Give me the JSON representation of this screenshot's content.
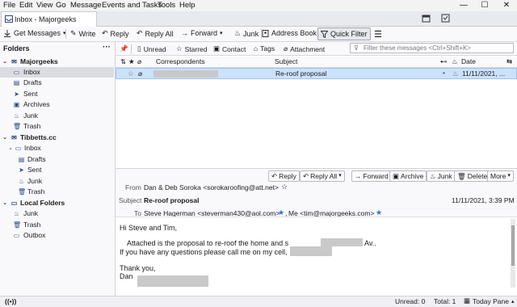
{
  "menubar": {
    "items": [
      "File",
      "Edit",
      "View",
      "Go",
      "Message",
      "Events and Tasks",
      "Tools",
      "Help"
    ]
  },
  "window": {
    "minimize": "—",
    "maximize": "☐",
    "close": "✕"
  },
  "tab": {
    "title": "Inbox - Majorgeeks"
  },
  "toolbar": {
    "get_messages": "Get Messages",
    "write": "Write",
    "reply": "Reply",
    "reply_all": "Reply All",
    "forward": "Forward",
    "junk": "Junk",
    "address_book": "Address Book",
    "quick_filter": "Quick Filter"
  },
  "folders": {
    "header": "Folders",
    "accounts": [
      {
        "name": "Majorgeeks",
        "children": [
          "Inbox",
          "Drafts",
          "Sent",
          "Archives",
          "Junk",
          "Trash"
        ]
      },
      {
        "name": "Tibbetts.cc",
        "children": [
          "Inbox",
          "Drafts",
          "Sent",
          "Junk",
          "Trash"
        ]
      },
      {
        "name": "Local Folders",
        "children": [
          "Junk",
          "Trash",
          "Outbox"
        ]
      }
    ]
  },
  "quickfilter": {
    "unread": "Unread",
    "starred": "Starred",
    "contact": "Contact",
    "tags": "Tags",
    "attachment": "Attachment",
    "placeholder": "Filter these messages <Ctrl+Shift+K>"
  },
  "columns": {
    "correspondents": "Correspondents",
    "subject": "Subject",
    "date": "Date"
  },
  "threads": [
    {
      "subject": "Re-roof proposal",
      "date": "11/11/2021, ..."
    }
  ],
  "message_header": {
    "buttons": {
      "reply": "Reply",
      "reply_all": "Reply All",
      "forward": "Forward",
      "archive": "Archive",
      "junk": "Junk",
      "delete": "Delete",
      "more": "More"
    },
    "from_label": "From",
    "from_value": "Dan & Deb Soroka <sorokaroofing@att.net>",
    "subject_label": "Subject",
    "subject_value": "Re-roof proposal",
    "date_value": "11/11/2021, 3:39 PM",
    "to_label": "To",
    "to_value_1": "Steve Hagerman <steverman430@aol.com>",
    "to_value_2": "Me <tim@majorgeeks.com>"
  },
  "body": {
    "greeting": "Hi Steve and Tim,",
    "line1a": "Attached is the proposal to re-roof the home and s",
    "line1b": "Av..",
    "line2": "If you have any questions please call me on my cell,",
    "thanks": "Thank you,",
    "sign": "Dan"
  },
  "statusbar": {
    "unread": "Unread: 0",
    "total": "Total: 1",
    "today_pane": "Today Pane"
  }
}
